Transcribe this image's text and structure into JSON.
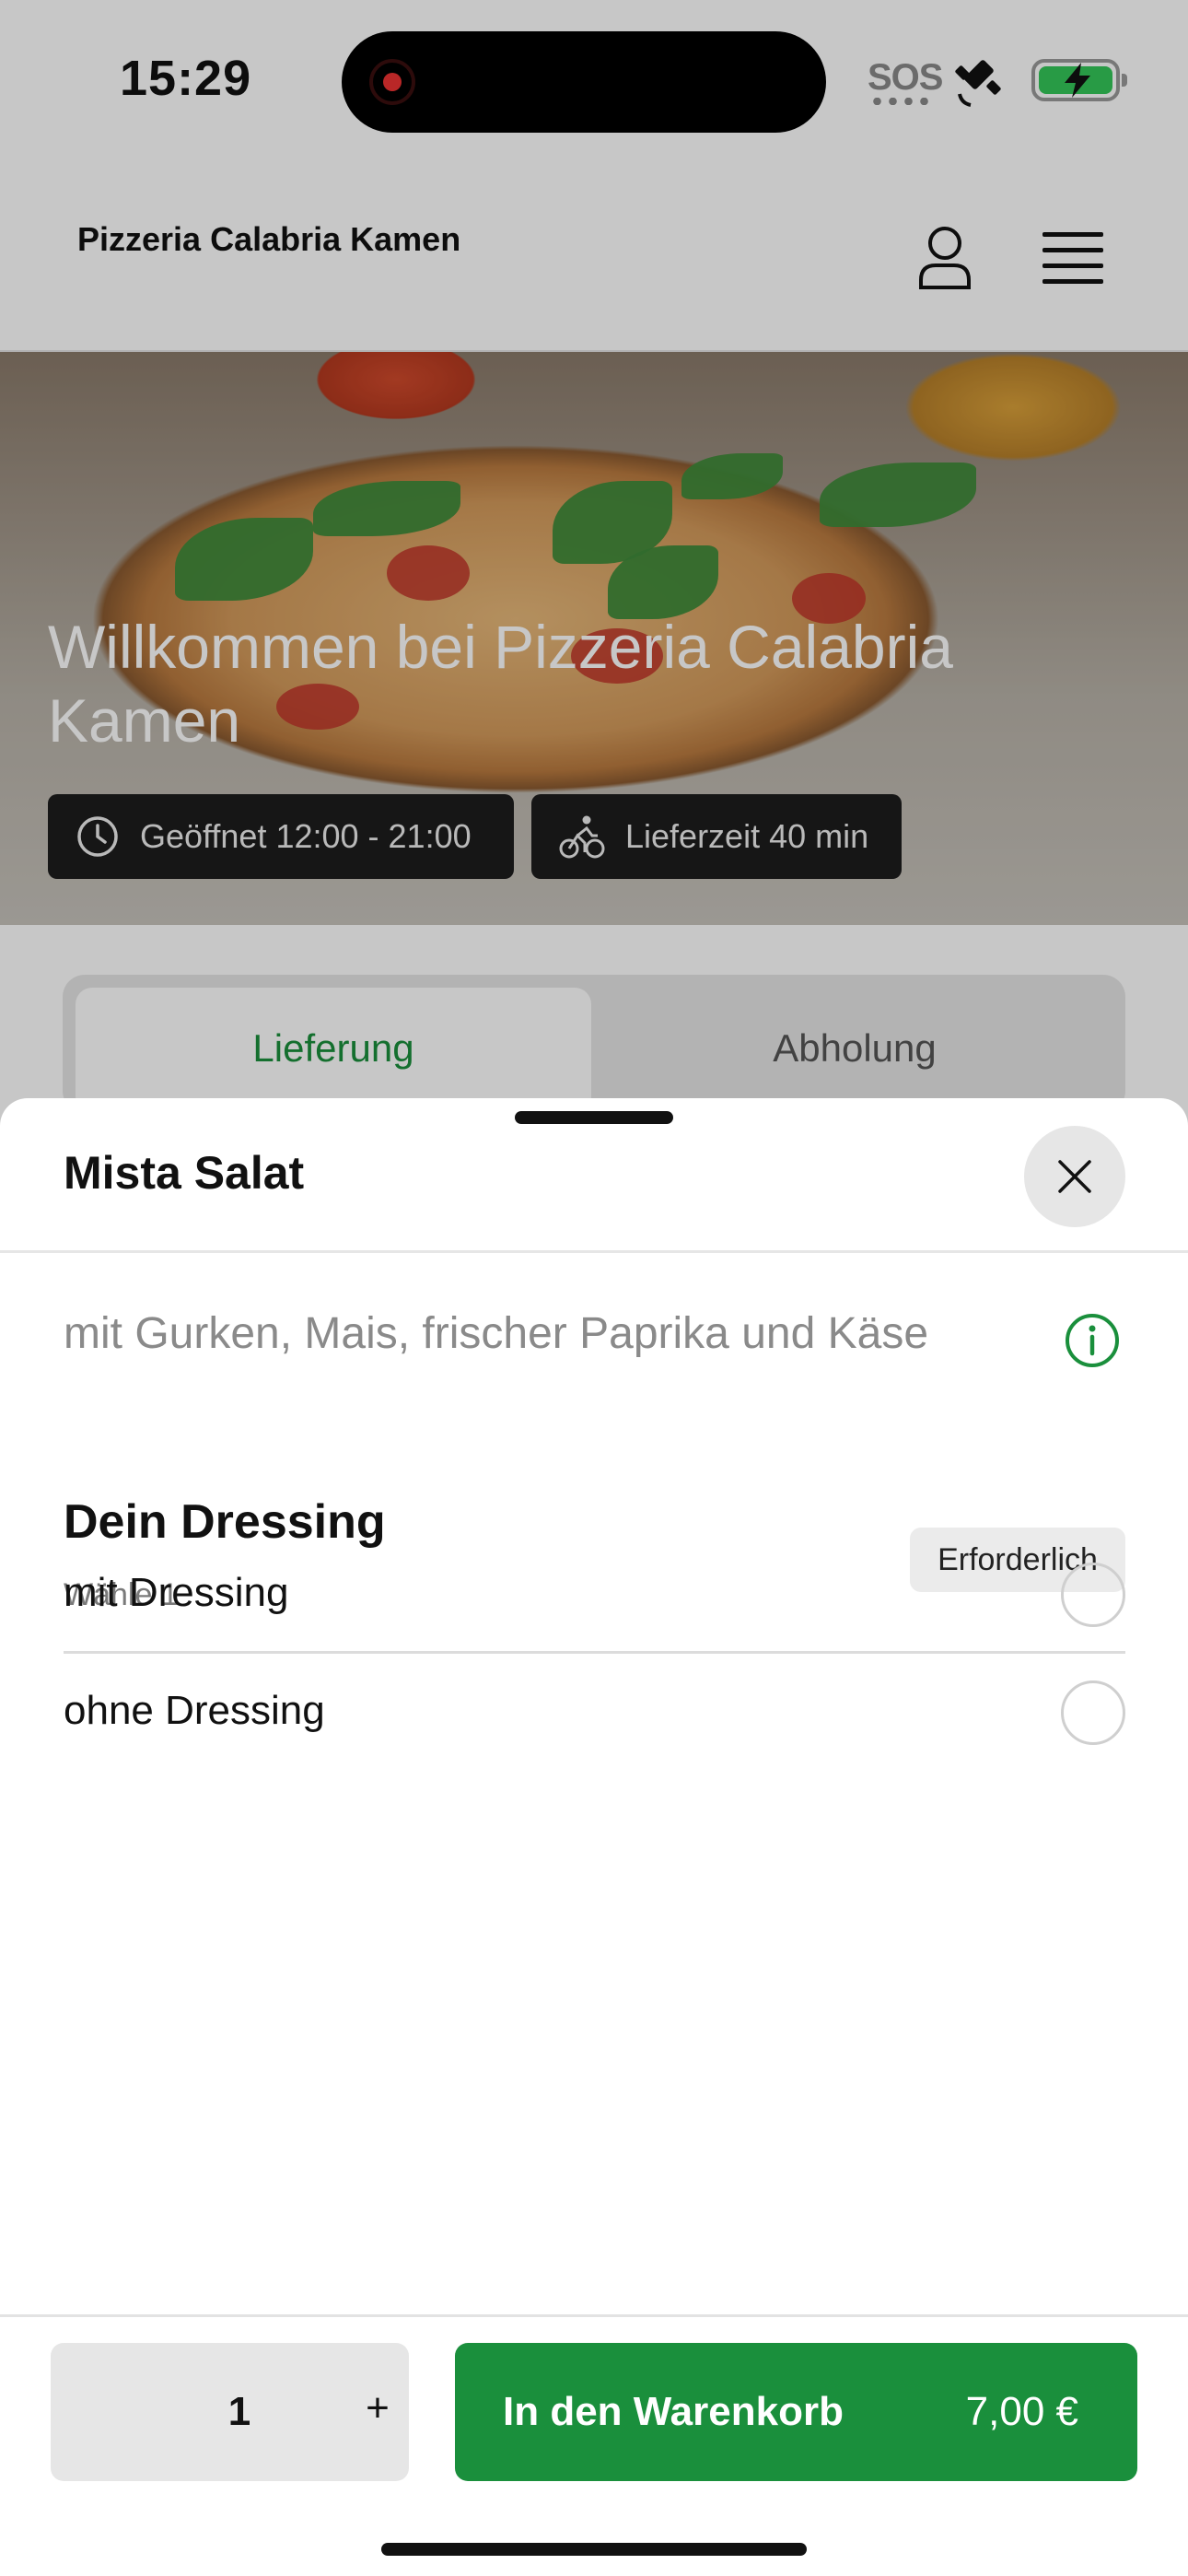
{
  "status_bar": {
    "time": "15:29",
    "sos": "SOS"
  },
  "header": {
    "brand": "Pizzeria Calabria Kamen"
  },
  "hero": {
    "title": "Willkommen bei Pizzeria Calabria Kamen",
    "opening_hours": "Geöffnet 12:00 - 21:00",
    "delivery_time": "Lieferzeit 40 min"
  },
  "order_tabs": [
    {
      "label": "Lieferung",
      "selected": true
    },
    {
      "label": "Abholung",
      "selected": false
    }
  ],
  "sheet": {
    "title": "Mista Salat",
    "description": "mit Gurken, Mais, frischer Paprika und Käse",
    "section": {
      "title": "Dein Dressing",
      "subtitle": "Wähle 1",
      "badge": "Erforderlich",
      "options": [
        {
          "label": "mit Dressing",
          "selected": false
        },
        {
          "label": "ohne Dressing",
          "selected": false
        }
      ]
    },
    "quantity": "1",
    "plus": "+",
    "cart_label": "In den Warenkorb",
    "price": "7,00 €"
  },
  "colors": {
    "accent": "#1a8f3c",
    "overlay": "rgba(0,0,0,0.22)"
  },
  "icons": [
    "record-icon",
    "satellite-icon",
    "battery-charging-icon",
    "user-icon",
    "menu-icon",
    "clock-icon",
    "bicycle-icon",
    "close-icon",
    "info-icon",
    "plus-icon"
  ]
}
